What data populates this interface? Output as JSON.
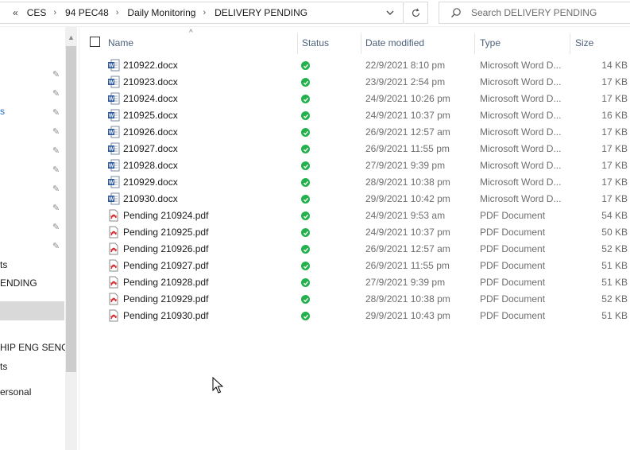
{
  "breadcrumb": {
    "overflow": "«",
    "items": [
      "CES",
      "94 PEC48",
      "Daily Monitoring",
      "DELIVERY PENDING"
    ]
  },
  "search": {
    "placeholder": "Search DELIVERY PENDING"
  },
  "nav": {
    "items": [
      {
        "label": "s",
        "selected": false
      },
      {
        "label": "ts",
        "selected": false
      },
      {
        "label": "ENDING",
        "selected": true
      },
      {
        "label": "HIP ENG SENG",
        "selected": false
      },
      {
        "label": "ts",
        "selected": false
      },
      {
        "label": "ersonal",
        "selected": false
      }
    ],
    "pin_icon": "pin-icon"
  },
  "columns": {
    "name": "Name",
    "status": "Status",
    "date": "Date modified",
    "type": "Type",
    "size": "Size"
  },
  "files": [
    {
      "name": "210922.docx",
      "date": "22/9/2021 8:10 pm",
      "type": "Microsoft Word D...",
      "size": "14 KB",
      "kind": "word"
    },
    {
      "name": "210923.docx",
      "date": "23/9/2021 2:54 pm",
      "type": "Microsoft Word D...",
      "size": "17 KB",
      "kind": "word"
    },
    {
      "name": "210924.docx",
      "date": "24/9/2021 10:26 pm",
      "type": "Microsoft Word D...",
      "size": "17 KB",
      "kind": "word"
    },
    {
      "name": "210925.docx",
      "date": "24/9/2021 10:37 pm",
      "type": "Microsoft Word D...",
      "size": "16 KB",
      "kind": "word"
    },
    {
      "name": "210926.docx",
      "date": "26/9/2021 12:57 am",
      "type": "Microsoft Word D...",
      "size": "17 KB",
      "kind": "word"
    },
    {
      "name": "210927.docx",
      "date": "26/9/2021 11:55 pm",
      "type": "Microsoft Word D...",
      "size": "17 KB",
      "kind": "word"
    },
    {
      "name": "210928.docx",
      "date": "27/9/2021 9:39 pm",
      "type": "Microsoft Word D...",
      "size": "17 KB",
      "kind": "word"
    },
    {
      "name": "210929.docx",
      "date": "28/9/2021 10:38 pm",
      "type": "Microsoft Word D...",
      "size": "17 KB",
      "kind": "word"
    },
    {
      "name": "210930.docx",
      "date": "29/9/2021 10:42 pm",
      "type": "Microsoft Word D...",
      "size": "17 KB",
      "kind": "word"
    },
    {
      "name": "Pending 210924.pdf",
      "date": "24/9/2021 9:53 am",
      "type": "PDF Document",
      "size": "54 KB",
      "kind": "pdf"
    },
    {
      "name": "Pending 210925.pdf",
      "date": "24/9/2021 10:37 pm",
      "type": "PDF Document",
      "size": "50 KB",
      "kind": "pdf"
    },
    {
      "name": "Pending 210926.pdf",
      "date": "26/9/2021 12:57 am",
      "type": "PDF Document",
      "size": "52 KB",
      "kind": "pdf"
    },
    {
      "name": "Pending 210927.pdf",
      "date": "26/9/2021 11:55 pm",
      "type": "PDF Document",
      "size": "51 KB",
      "kind": "pdf"
    },
    {
      "name": "Pending 210928.pdf",
      "date": "27/9/2021 9:39 pm",
      "type": "PDF Document",
      "size": "51 KB",
      "kind": "pdf"
    },
    {
      "name": "Pending 210929.pdf",
      "date": "28/9/2021 10:38 pm",
      "type": "PDF Document",
      "size": "52 KB",
      "kind": "pdf"
    },
    {
      "name": "Pending 210930.pdf",
      "date": "29/9/2021 10:43 pm",
      "type": "PDF Document",
      "size": "51 KB",
      "kind": "pdf"
    }
  ],
  "colors": {
    "status_ok": "#22b14c",
    "word_blue": "#2b579a",
    "pdf_red": "#d4262b",
    "selected_bg": "#d9d9d9"
  }
}
